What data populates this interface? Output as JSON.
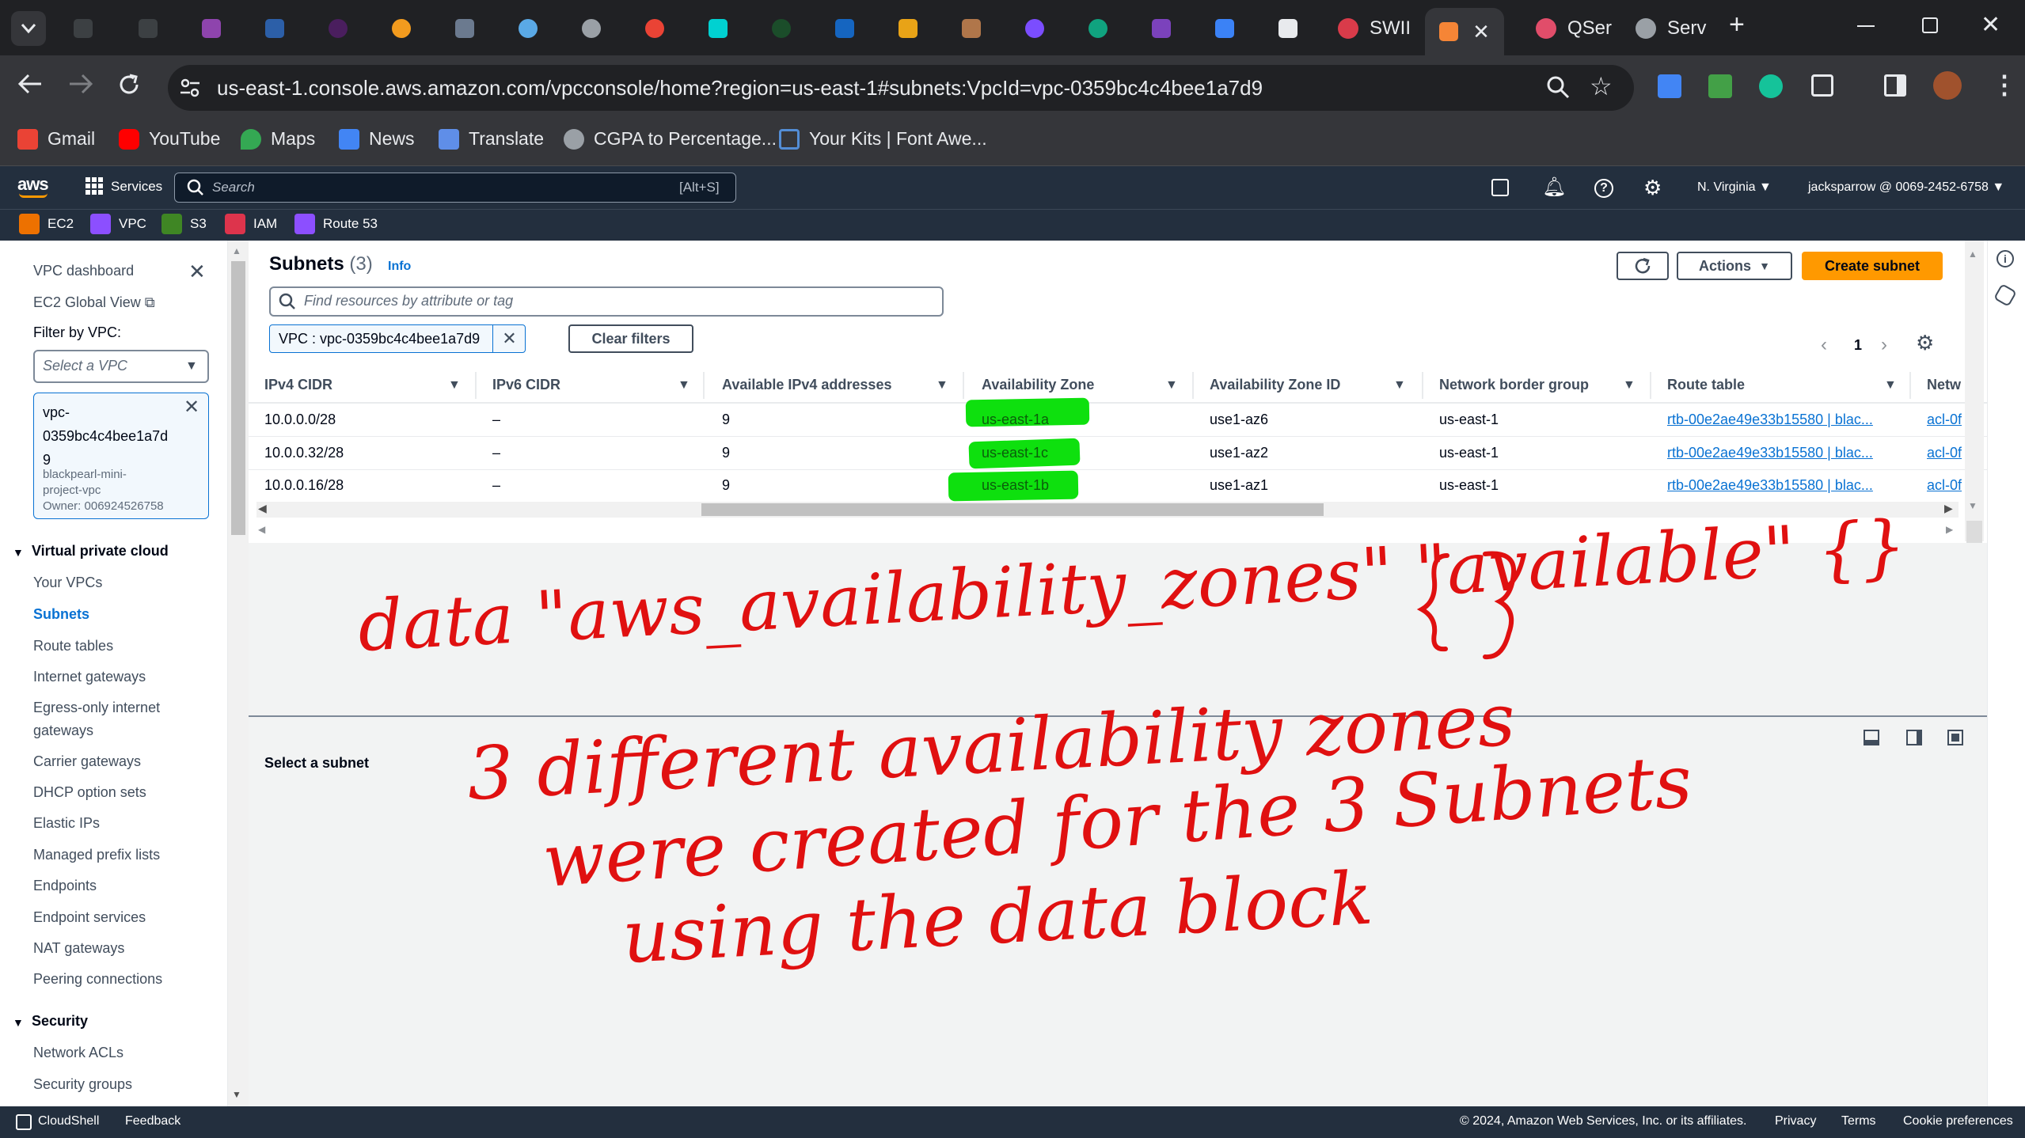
{
  "browser": {
    "tabs": [
      {
        "title": "SWII"
      },
      {
        "title": "QSer"
      },
      {
        "title": "Serv"
      }
    ],
    "url": "us-east-1.console.aws.amazon.com/vpcconsole/home?region=us-east-1#subnets:VpcId=vpc-0359bc4c4bee1a7d9",
    "bookmarks": [
      "Gmail",
      "YouTube",
      "Maps",
      "News",
      "Translate",
      "CGPA to Percentage...",
      "Your Kits | Font Awe..."
    ]
  },
  "aws": {
    "logo": "aws",
    "services": "Services",
    "search_placeholder": "Search",
    "search_shortcut": "[Alt+S]",
    "region": "N. Virginia",
    "account": "jacksparrow @ 0069-2452-6758",
    "favorites": [
      {
        "label": "EC2",
        "color": "#ed7100"
      },
      {
        "label": "VPC",
        "color": "#8c4fff"
      },
      {
        "label": "S3",
        "color": "#3f8624"
      },
      {
        "label": "IAM",
        "color": "#dd344c"
      },
      {
        "label": "Route 53",
        "color": "#8c4fff"
      }
    ]
  },
  "sidebar": {
    "dashboard": "VPC dashboard",
    "global_view": "EC2 Global View",
    "filter_label": "Filter by VPC:",
    "select_placeholder": "Select a VPC",
    "selected_vpc": {
      "id_line1": "vpc-",
      "id_line2": "0359bc4c4bee1a7d",
      "id_line3": "9",
      "name_line1": "blackpearl-mini-",
      "name_line2": "project-vpc",
      "owner": "Owner: 006924526758"
    },
    "section1": "Virtual private cloud",
    "items": [
      "Your VPCs",
      "Subnets",
      "Route tables",
      "Internet gateways",
      "Egress-only internet",
      "gateways",
      "Carrier gateways",
      "DHCP option sets",
      "Elastic IPs",
      "Managed prefix lists",
      "Endpoints",
      "Endpoint services",
      "NAT gateways",
      "Peering connections"
    ],
    "section2": "Security",
    "security_items": [
      "Network ACLs",
      "Security groups"
    ]
  },
  "main": {
    "title": "Subnets",
    "count": "(3)",
    "info": "Info",
    "actions": "Actions",
    "create": "Create subnet",
    "filter_placeholder": "Find resources by attribute or tag",
    "filter_token": "VPC : vpc-0359bc4c4bee1a7d9",
    "clear_filters": "Clear filters",
    "page": "1",
    "columns": [
      "IPv4 CIDR",
      "IPv6 CIDR",
      "Available IPv4 addresses",
      "Availability Zone",
      "Availability Zone ID",
      "Network border group",
      "Route table",
      "Netw"
    ],
    "rows": [
      {
        "ipv4": "10.0.0.0/28",
        "ipv6": "–",
        "avail": "9",
        "az": "us-east-1a",
        "azid": "use1-az6",
        "nbg": "us-east-1",
        "rt": "rtb-00e2ae49e33b15580 | blac...",
        "nacl": "acl-0f"
      },
      {
        "ipv4": "10.0.0.32/28",
        "ipv6": "–",
        "avail": "9",
        "az": "us-east-1c",
        "azid": "use1-az2",
        "nbg": "us-east-1",
        "rt": "rtb-00e2ae49e33b15580 | blac...",
        "nacl": "acl-0f"
      },
      {
        "ipv4": "10.0.0.16/28",
        "ipv6": "–",
        "avail": "9",
        "az": "us-east-1b",
        "azid": "use1-az1",
        "nbg": "us-east-1",
        "rt": "rtb-00e2ae49e33b15580 | blac...",
        "nacl": "acl-0f"
      }
    ],
    "select_subnet": "Select a subnet"
  },
  "annotation": {
    "line1": "data \"aws_availability_zones\" \"available\" {}",
    "line2": "3 different availability zones",
    "line3": "were created for the 3 Subnets",
    "line4": "using the data block",
    "ink_color": "#e01010"
  },
  "footer": {
    "cloudshell": "CloudShell",
    "feedback": "Feedback",
    "copyright": "© 2024, Amazon Web Services, Inc. or its affiliates.",
    "privacy": "Privacy",
    "terms": "Terms",
    "cookies": "Cookie preferences"
  }
}
